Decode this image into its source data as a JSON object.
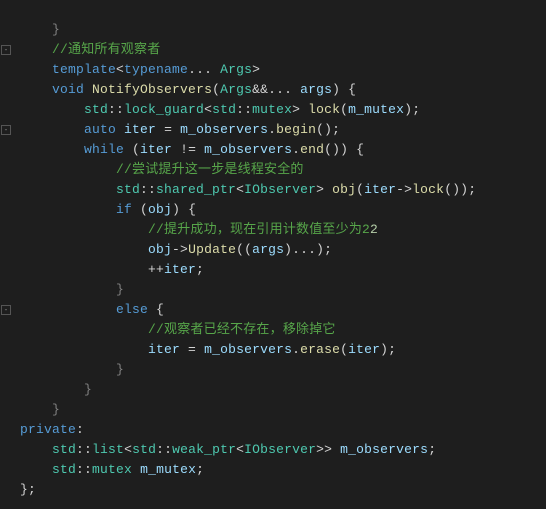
{
  "lines": {
    "l0": "    }",
    "c1": "    //通知所有观察者",
    "l2a": "    ",
    "l2_kw": "template",
    "l2b": "<",
    "l2_kw2": "typename",
    "l2c": "... ",
    "l2_ty": "Args",
    "l2d": ">",
    "l3a": "    ",
    "l3_kw": "void",
    "l3b": " ",
    "l3_fn": "NotifyObservers",
    "l3c": "(",
    "l3_ty": "Args",
    "l3d": "&&... ",
    "l3_va": "args",
    "l3e": ") {",
    "l4a": "        ",
    "l4_ty1": "std",
    "l4b": "::",
    "l4_ty2": "lock_guard",
    "l4c": "<",
    "l4_ty3": "std",
    "l4d": "::",
    "l4_ty4": "mutex",
    "l4e": "> ",
    "l4_fn": "lock",
    "l4f": "(",
    "l4_va": "m_mutex",
    "l4g": ");",
    "l5a": "        ",
    "l5_kw": "auto",
    "l5b": " ",
    "l5_va": "iter",
    "l5c": " = ",
    "l5_va2": "m_observers",
    "l5d": ".",
    "l5_fn": "begin",
    "l5e": "();",
    "l6a": "        ",
    "l6_kw": "while",
    "l6b": " (",
    "l6_va": "iter",
    "l6c": " != ",
    "l6_va2": "m_observers",
    "l6d": ".",
    "l6_fn": "end",
    "l6e": "()) {",
    "c7": "            //尝试提升这一步是线程安全的",
    "l8a": "            ",
    "l8_ty1": "std",
    "l8b": "::",
    "l8_ty2": "shared_ptr",
    "l8c": "<",
    "l8_ty3": "IObserver",
    "l8d": "> ",
    "l8_fn": "obj",
    "l8e": "(",
    "l8_va": "iter",
    "l8f": "->",
    "l8_fn2": "lock",
    "l8g": "());",
    "l9a": "            ",
    "l9_kw": "if",
    "l9b": " (",
    "l9_va": "obj",
    "l9c": ") {",
    "c10": "                //提升成功，现在引用计数值至少为2",
    "l11a": "                ",
    "l11_va": "obj",
    "l11b": "->",
    "l11_fn": "Update",
    "l11c": "((",
    "l11_va2": "args",
    "l11d": ")...);",
    "l12a": "                ++",
    "l12_va": "iter",
    "l12b": ";",
    "l13": "            }",
    "l14a": "            ",
    "l14_kw": "else",
    "l14b": " {",
    "c15": "                //观察者已经不存在，移除掉它",
    "l16a": "                ",
    "l16_va": "iter",
    "l16b": " = ",
    "l16_va2": "m_observers",
    "l16c": ".",
    "l16_fn": "erase",
    "l16d": "(",
    "l16_va3": "iter",
    "l16e": ");",
    "l17": "            }",
    "l18": "        }",
    "l19": "    }",
    "l20": "private",
    "l20b": ":",
    "l21a": "    ",
    "l21_ty1": "std",
    "l21b": "::",
    "l21_ty2": "list",
    "l21c": "<",
    "l21_ty3": "std",
    "l21d": "::",
    "l21_ty4": "weak_ptr",
    "l21e": "<",
    "l21_ty5": "IObserver",
    "l21f": ">> ",
    "l21_va": "m_observers",
    "l21g": ";",
    "l22a": "    ",
    "l22_ty1": "std",
    "l22b": "::",
    "l22_ty2": "mutex",
    "l22c": " ",
    "l22_va": "m_mutex",
    "l22d": ";",
    "l23": "};",
    "num2": "2"
  }
}
